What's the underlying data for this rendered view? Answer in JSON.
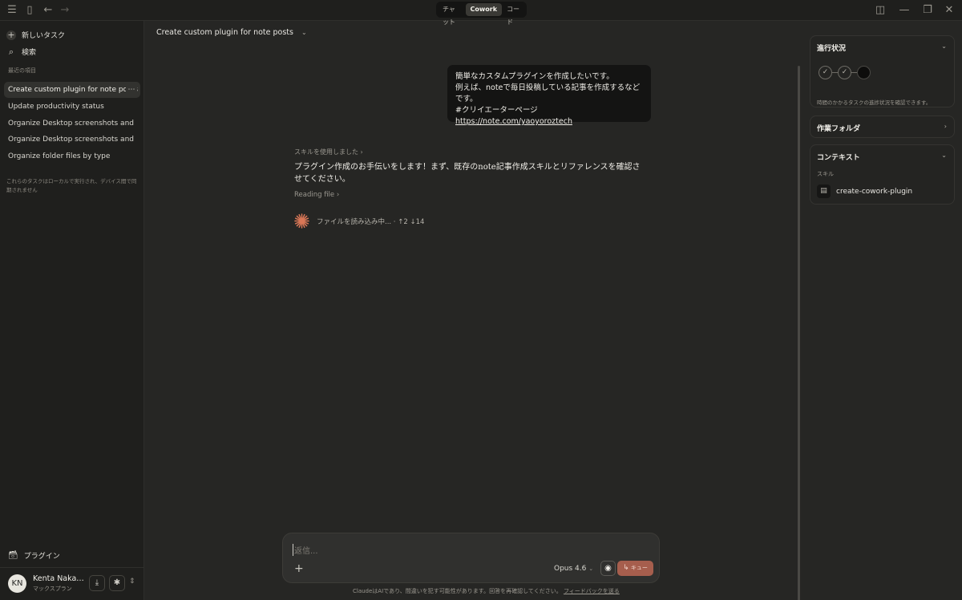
{
  "topbar": {
    "modes": [
      "チャット",
      "Cowork",
      "コード"
    ],
    "active_mode": "Cowork"
  },
  "sidebar": {
    "new_task": "新しいタスク",
    "search": "検索",
    "recent_label": "最近の項目",
    "items": [
      "Create custom plugin for note posts",
      "Update productivity status",
      "Organize Desktop screenshots and",
      "Organize Desktop screenshots and",
      "Organize folder files by type"
    ],
    "local_note": "これらのタスクはローカルで実行され、デバイス間で同期されません",
    "plugins": "プラグイン",
    "user": {
      "initials": "KN",
      "name": "Kenta Nakam...",
      "plan": "マックスプラン"
    }
  },
  "main": {
    "task_title": "Create custom plugin for note posts",
    "user_message": {
      "line1": "簡単なカスタムプラグインを作成したいです。",
      "line2": "例えば、noteで毎日投稿している記事を作成するなどです。",
      "line3": "#クリイエーターページ",
      "link": "https://note.com/yaoyoroztech"
    },
    "skill_used": "スキルを使用しました",
    "assistant_text": "プラグイン作成のお手伝いをします！まず、既存のnote記事作成スキルとリファレンスを確認させてください。",
    "reading_file": "Reading file",
    "loading_status": "ファイルを読み込み中... · ↑2 ↓14"
  },
  "composer": {
    "placeholder": "返信...",
    "model": "Opus 4.6",
    "queue_label": "キュー"
  },
  "footer": {
    "note": "ClaudeはAIであり、間違いを犯す可能性があります。回答を再確認してください。",
    "feedback": "フィードバックを送る"
  },
  "right_panel": {
    "progress": {
      "title": "進行状況",
      "desc": "時間のかかるタスクの進捗状況を確認できます。"
    },
    "work_folder": {
      "title": "作業フォルダ"
    },
    "context": {
      "title": "コンテキスト",
      "skills_label": "スキル",
      "skill_name": "create-cowork-plugin"
    }
  }
}
